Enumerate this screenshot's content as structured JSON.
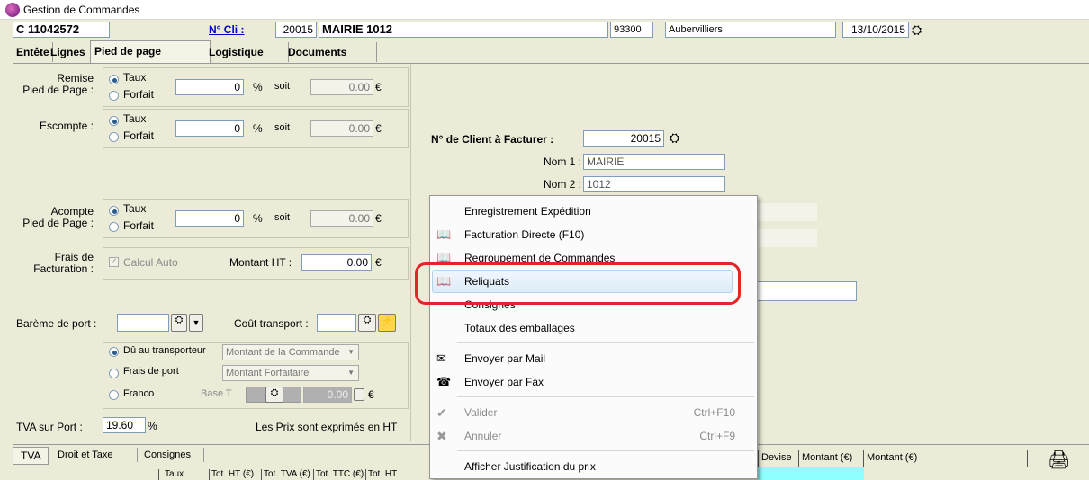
{
  "window": {
    "title": "Gestion de Commandes"
  },
  "header": {
    "order_number": "C 11042572",
    "client_label": "N° Cli :",
    "client_number": "20015",
    "client_name": "MAIRIE 1012",
    "postal_code": "93300",
    "city": "Aubervilliers",
    "date": "13/10/2015"
  },
  "tabs": [
    "Entête",
    "Lignes",
    "Pied de page",
    "Logistique",
    "Documents"
  ],
  "active_tab": "Pied de page",
  "footer": {
    "remise_label": "Remise\nPied de Page :",
    "escompte_label": "Escompte :",
    "acompte_label": "Acompte\nPied de Page :",
    "taux": "Taux",
    "forfait": "Forfait",
    "zero": "0",
    "percent": "%",
    "soit": "soit",
    "zero_amount": "0.00",
    "euro": "€",
    "frais_label": "Frais de\nFacturation :",
    "calcul_auto": "Calcul Auto",
    "montant_ht_label": "Montant HT :",
    "montant_ht_value": "0.00",
    "bareme_label": "Barème de port :",
    "cout_label": "Coût transport :",
    "du_transporteur": "Dû au transporteur",
    "montant_commande": "Montant de la Commande",
    "frais_de_port": "Frais de port",
    "montant_forfaitaire": "Montant Forfaitaire",
    "franco": "Franco",
    "base_t": "Base T",
    "tva_port_label": "TVA sur Port :",
    "tva_port_value": "19.60",
    "prix_ht_note": "Les Prix sont exprimés en HT"
  },
  "billing": {
    "client_label": "N° de Client à Facturer :",
    "client_value": "20015",
    "nom1_label": "Nom 1 :",
    "nom1_value": "MAIRIE",
    "nom2_label": "Nom 2 :",
    "nom2_value": "1012"
  },
  "bottom_tabs": [
    "TVA",
    "Droit et Taxe",
    "Consignes"
  ],
  "bottom_grid": {
    "left_headers": [
      "Taux",
      "Tot. HT (€)",
      "Tot. TVA (€)",
      "Tot. TTC (€)",
      "Tot. HT"
    ],
    "right_headers": [
      "Devise",
      "Montant (€)",
      "Montant (€)"
    ]
  },
  "context_menu": {
    "items": [
      {
        "label": "Enregistrement Expédition",
        "shortcut": "",
        "icon": "none",
        "disabled": false
      },
      {
        "label": "Facturation Directe (F10)",
        "shortcut": "",
        "icon": "book-icon",
        "disabled": false
      },
      {
        "label": "Regroupement de Commandes",
        "shortcut": "",
        "icon": "book-icon",
        "disabled": false
      },
      {
        "label": "Reliquats",
        "shortcut": "",
        "icon": "book-icon",
        "disabled": false,
        "highlighted": true
      },
      {
        "label": "Consignes",
        "shortcut": "",
        "icon": "none",
        "disabled": false
      },
      {
        "label": "Totaux des emballages",
        "shortcut": "",
        "icon": "none",
        "disabled": false
      },
      {
        "label": "Envoyer par Mail",
        "shortcut": "",
        "icon": "mail-icon",
        "disabled": false
      },
      {
        "label": "Envoyer par Fax",
        "shortcut": "",
        "icon": "fax-icon",
        "disabled": false
      },
      {
        "label": "Valider",
        "shortcut": "Ctrl+F10",
        "icon": "check-icon",
        "disabled": true
      },
      {
        "label": "Annuler",
        "shortcut": "Ctrl+F9",
        "icon": "cross-icon",
        "disabled": true
      },
      {
        "label": "Afficher Justification du prix",
        "shortcut": "",
        "icon": "none",
        "disabled": false
      }
    ]
  },
  "colors": {
    "highlight_ring": "#e0262b",
    "grid_cyan": "#8fffff"
  }
}
